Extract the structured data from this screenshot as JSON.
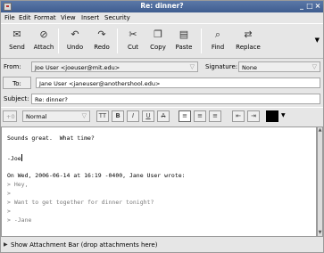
{
  "window": {
    "title": "Re: dinner?"
  },
  "menu": [
    "File",
    "Edit",
    "Format",
    "View",
    "Insert",
    "Security"
  ],
  "toolbar": [
    {
      "label": "Send",
      "icon": "send-icon"
    },
    {
      "label": "Attach",
      "icon": "paperclip-icon"
    },
    {
      "label": "Undo",
      "icon": "undo-icon"
    },
    {
      "label": "Redo",
      "icon": "redo-icon"
    },
    {
      "label": "Cut",
      "icon": "scissors-icon"
    },
    {
      "label": "Copy",
      "icon": "copy-icon"
    },
    {
      "label": "Paste",
      "icon": "paste-icon"
    },
    {
      "label": "Find",
      "icon": "find-icon"
    },
    {
      "label": "Replace",
      "icon": "replace-icon"
    }
  ],
  "header": {
    "from_label": "From:",
    "from_value": "Joe User <joeuser@mit.edu>",
    "signature_label": "Signature:",
    "signature_value": "None",
    "to_label": "To:",
    "to_value": "Jane User <janeuser@anothershool.edu>",
    "subject_label": "Subject:",
    "subject_value": "Re: dinner?"
  },
  "format": {
    "size_value": "+0",
    "paragraph_style": "Normal",
    "buttons": [
      "TT",
      "B",
      "I",
      "U",
      "A"
    ]
  },
  "body": {
    "lines": [
      "Sounds great.  What time?",
      "",
      "-Joe",
      "",
      "On Wed, 2006-06-14 at 16:19 -0400, Jane User wrote:",
      "> Hey,",
      ">",
      "> Want to get together for dinner tonight?",
      ">",
      "> -Jane"
    ]
  },
  "attach_bar": {
    "label": "Show Attachment Bar (drop attachments here)"
  },
  "colors": {
    "titlebar": "#4a679a",
    "quoted_text": "#7a7a7a"
  }
}
